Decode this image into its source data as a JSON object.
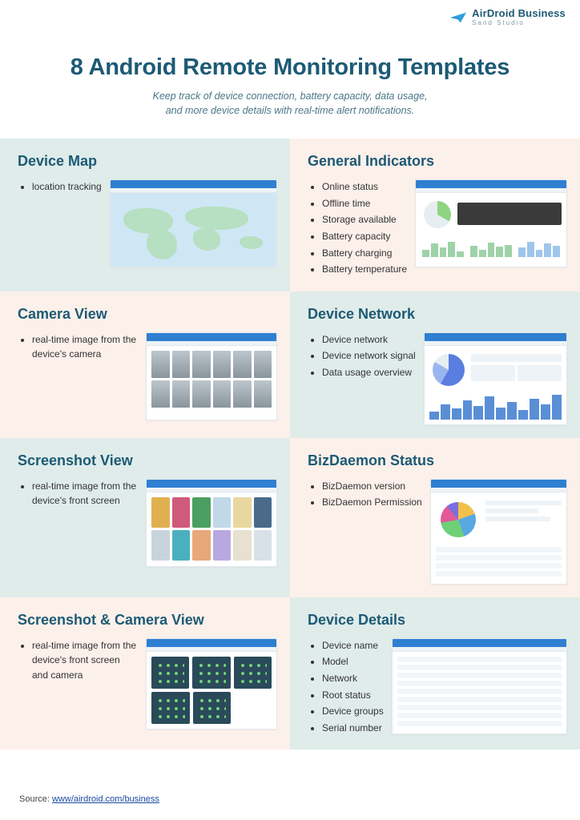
{
  "brand": {
    "name": "AirDroid Business",
    "sub": "Sand Studio"
  },
  "title": "8 Android Remote Monitoring Templates",
  "subtitle_line1": "Keep track of device connection, battery capacity, data usage,",
  "subtitle_line2": "and more device details with real-time alert notifications.",
  "cards": [
    {
      "title": "Device Map",
      "items": [
        "location tracking"
      ]
    },
    {
      "title": "General Indicators",
      "items": [
        "Online status",
        "Offline time",
        "Storage available",
        "Battery capacity",
        "Battery charging",
        "Battery temperature"
      ]
    },
    {
      "title": "Camera View",
      "items": [
        "real-time image from the device's camera"
      ]
    },
    {
      "title": "Device Network",
      "items": [
        "Device network",
        "Device network signal",
        "Data usage overview"
      ]
    },
    {
      "title": "Screenshot View",
      "items": [
        "real-time image from the device's front screen"
      ]
    },
    {
      "title": "BizDaemon Status",
      "items": [
        "BizDaemon version",
        "BizDaemon Permission"
      ]
    },
    {
      "title": "Screenshot & Camera View",
      "items": [
        "real-time image from the device's front screen and camera"
      ]
    },
    {
      "title": "Device Details",
      "items": [
        "Device name",
        "Model",
        "Network",
        "Root status",
        "Device groups",
        "Serial number"
      ]
    }
  ],
  "source": {
    "label": "Source:",
    "link_text": "www/airdroid.com/business"
  }
}
